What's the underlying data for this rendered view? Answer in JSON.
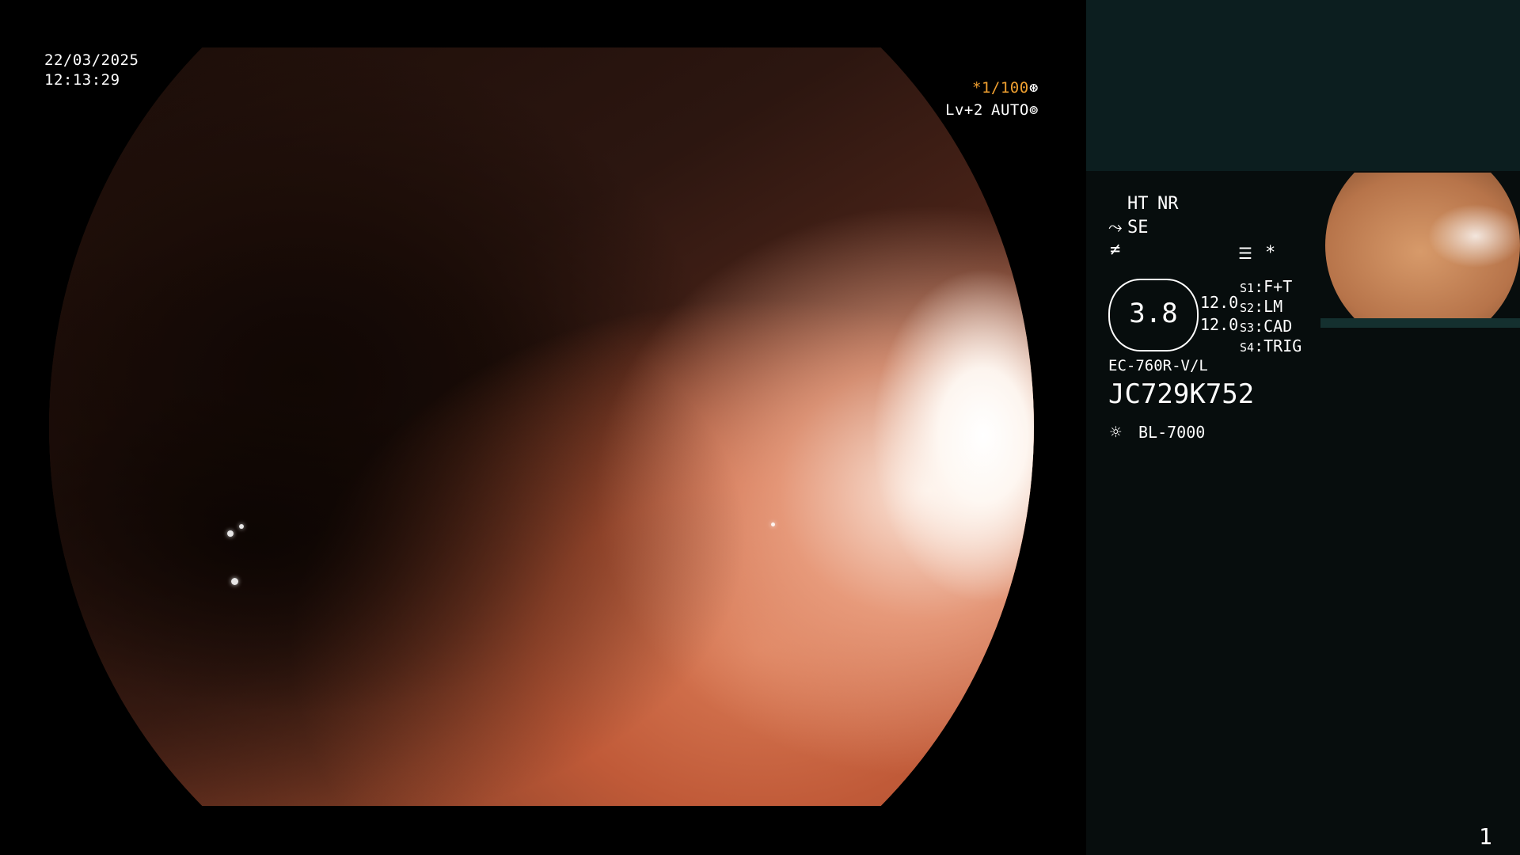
{
  "datetime": {
    "date": "22/03/2025",
    "time": "12:13:29"
  },
  "overlay": {
    "shutter": "*1/100",
    "level": "Lv+2",
    "mode": "AUTO"
  },
  "settings": {
    "ht": "HT",
    "nr": "NR",
    "se": "SE",
    "star": "*",
    "zoom": "3.8",
    "value1": "12.0",
    "value2": "12.0",
    "s1_key": "S1",
    "s1_val": "F+T",
    "s2_key": "S2",
    "s2_val": "LM",
    "s3_key": "S3",
    "s3_val": "CAD",
    "s4_key": "S4",
    "s4_val": "TRIG"
  },
  "device": {
    "scope_model": "EC-760R-V/L",
    "serial": "JC729K752",
    "light_source": "BL-7000"
  },
  "page_number": "1",
  "colors": {
    "accent_orange": "#f0a030",
    "sidebar_bg": "#070d0d",
    "sidebar_top_bg": "#0c1e1f"
  },
  "icons": [
    "shutter-icon",
    "auto-iris-icon",
    "scope-icon",
    "structure-icon",
    "preset-icon",
    "light-source-icon"
  ]
}
